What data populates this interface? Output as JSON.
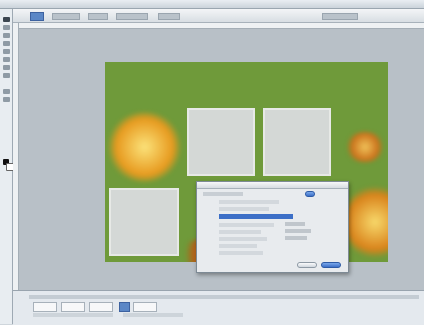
{
  "app": {
    "menu_items": [
      "",
      "",
      "",
      "",
      "",
      "",
      "",
      "",
      "",
      ""
    ]
  },
  "colors": {
    "canvas_background": "#6f9a3a",
    "dialog_highlight": "#3c6fc7",
    "accent_button": "#5b87c6"
  },
  "icons": {
    "toolbar_tools": [
      "move-icon",
      "marquee-icon",
      "lasso-icon",
      "crop-icon",
      "brush-icon",
      "eraser-icon",
      "text-icon",
      "zoom-icon"
    ]
  }
}
